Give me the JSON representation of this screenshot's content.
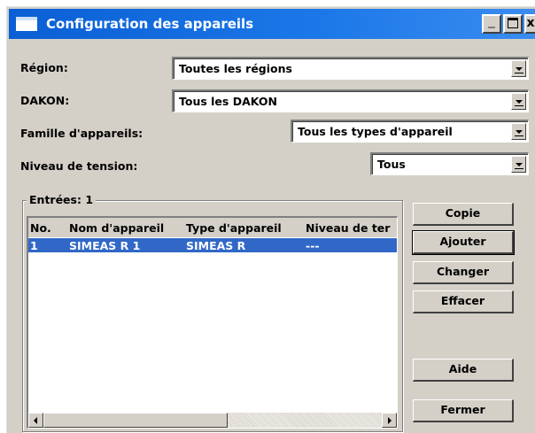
{
  "window": {
    "title": "Configuration des appareils",
    "controls": {
      "minimize": "_",
      "maximize": "□",
      "close": "x"
    }
  },
  "filters": {
    "region": {
      "label": "Région:",
      "value": "Toutes les régions"
    },
    "dakon": {
      "label": "DAKON:",
      "value": "Tous les DAKON"
    },
    "device_family": {
      "label": "Famille d'appareils:",
      "value": "Tous les types d'appareil"
    },
    "voltage_level": {
      "label": "Niveau de tension:",
      "value": "Tous"
    }
  },
  "entries": {
    "label": "Entrées: 1",
    "columns": [
      "No.",
      "Nom d'appareil",
      "Type d'appareil",
      "Niveau de ter"
    ],
    "rows": [
      {
        "no": "1",
        "name": "SIMEAS R 1",
        "type": "SIMEAS R",
        "level": "---",
        "selected": true
      }
    ]
  },
  "buttons": {
    "copy": "Copie",
    "add": "Ajouter",
    "change": "Changer",
    "delete": "Effacer",
    "help": "Aide",
    "close": "Fermer"
  },
  "colors": {
    "titlebar": "#0a64d8",
    "selection": "#3168c8",
    "face": "#d4d0c8"
  }
}
